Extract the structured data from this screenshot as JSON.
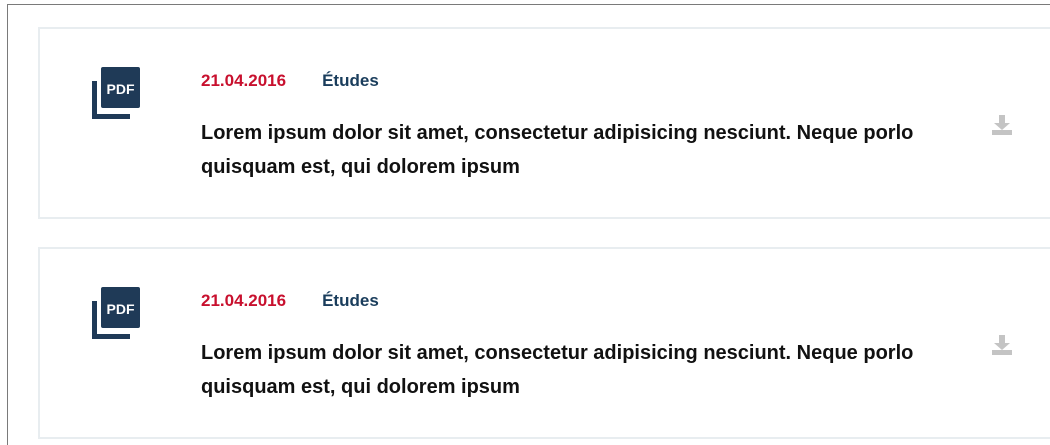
{
  "documents": [
    {
      "icon": "pdf-file-icon",
      "icon_label": "PDF",
      "date": "21.04.2016",
      "category": "Études",
      "title": "Lorem ipsum dolor sit amet, consectetur adipisicing nesciunt. Neque porlo quisquam est, qui dolorem ipsum",
      "action_icon": "download-icon"
    },
    {
      "icon": "pdf-file-icon",
      "icon_label": "PDF",
      "date": "21.04.2016",
      "category": "Études",
      "title": "Lorem ipsum dolor sit amet, consectetur adipisicing nesciunt. Neque porlo quisquam est, qui dolorem ipsum",
      "action_icon": "download-icon"
    }
  ],
  "colors": {
    "date": "#c8102e",
    "category": "#1a3d5c",
    "icon": "#1f3a57",
    "download_icon": "#c4c4c4",
    "card_border": "#e8edf0"
  }
}
